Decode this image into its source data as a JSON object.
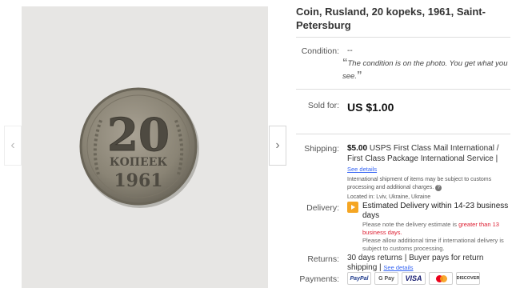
{
  "listing": {
    "title": "Coin, Rusland, 20 kopeks, 1961, Saint-Petersburg"
  },
  "gallery": {
    "prev_glyph": "‹",
    "next_glyph": "›",
    "coin": {
      "denomination": "20",
      "word": "КОПЕЕК",
      "year": "1961"
    }
  },
  "condition": {
    "label": "Condition:",
    "value": "--",
    "open_quote": "“",
    "note": "The condition is on the photo. You get what you see.",
    "close_quote": "”"
  },
  "sold": {
    "label": "Sold for:",
    "price": "US $1.00"
  },
  "shipping": {
    "label": "Shipping:",
    "cost": "$5.00",
    "service": "USPS First Class Mail International / First Class Package International Service |",
    "see_details": "See details",
    "note": "International shipment of items may be subject to customs processing and additional charges.",
    "location": "Located in:  Lviv, Ukraine, Ukraine"
  },
  "delivery": {
    "label": "Delivery:",
    "estimate": "Estimated Delivery within 14-23 business days",
    "note_prefix": "Please note the delivery estimate is ",
    "note_warn": "greater than 13 business days.",
    "note_suffix": "Please allow additional time if international delivery is subject to customs processing."
  },
  "returns": {
    "label": "Returns:",
    "text": "30 days returns | Buyer pays for return shipping |",
    "see_details": "See details"
  },
  "payments": {
    "label": "Payments:",
    "methods": [
      "PayPal",
      "G Pay",
      "VISA",
      "mastercard",
      "DISCOVER"
    ]
  },
  "colors": {
    "link": "#3665f3",
    "warning": "#dd1e31",
    "delivery_icon": "#f5a623"
  }
}
